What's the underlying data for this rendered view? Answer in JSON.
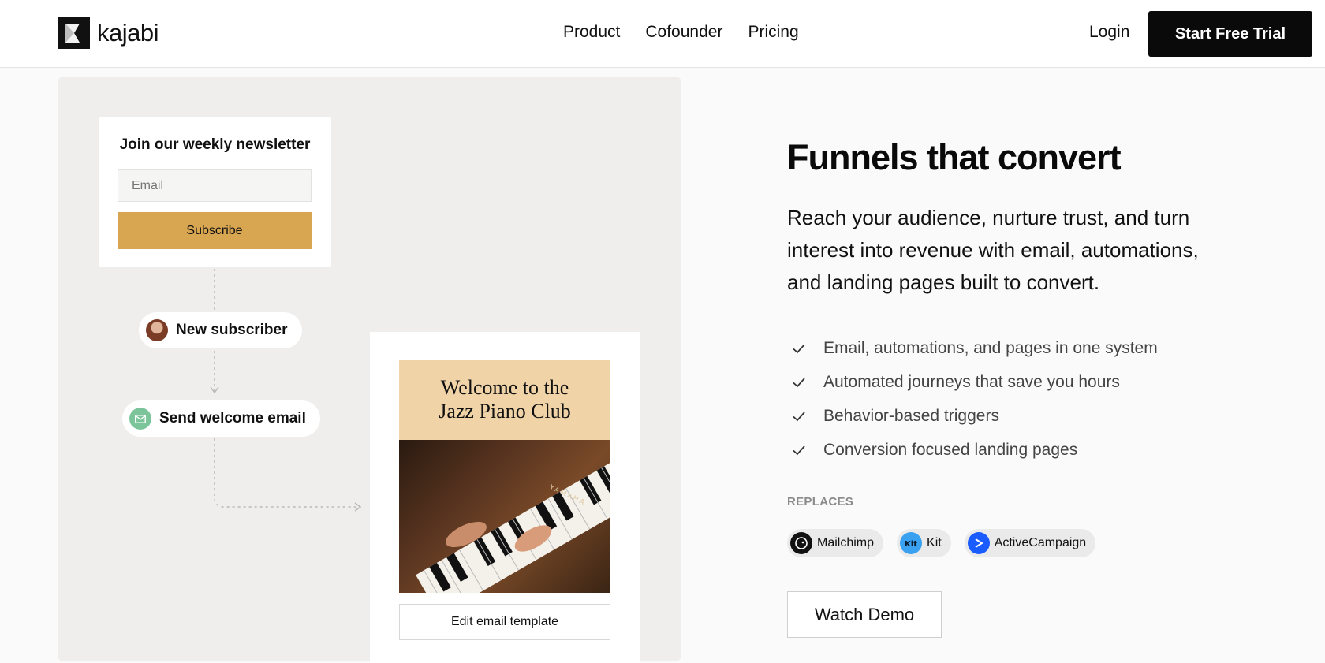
{
  "header": {
    "logo_text": "kajabi",
    "nav": [
      "Product",
      "Cofounder",
      "Pricing"
    ],
    "login_label": "Login",
    "cta_label": "Start Free Trial"
  },
  "illustration": {
    "newsletter": {
      "title": "Join our weekly newsletter",
      "email_placeholder": "Email",
      "subscribe_label": "Subscribe"
    },
    "steps": {
      "new_subscriber": "New subscriber",
      "send_welcome": "Send welcome email"
    },
    "email_preview": {
      "heading_line1": "Welcome to the",
      "heading_line2": "Jazz Piano Club",
      "brand_text": "YAMAHA",
      "edit_label": "Edit email template"
    }
  },
  "content": {
    "title": "Funnels that convert",
    "lede": "Reach your audience, nurture trust, and turn interest into revenue with email, automations, and landing pages built to convert.",
    "features": [
      "Email, automations, and pages in one system",
      "Automated journeys that save you hours",
      "Behavior-based triggers",
      "Conversion focused landing pages"
    ],
    "replaces_label": "REPLACES",
    "replaces": [
      {
        "name": "Mailchimp",
        "icon": "mailchimp-icon",
        "color": "#111111"
      },
      {
        "name": "Kit",
        "icon": "kit-icon",
        "color": "#3aa0f0"
      },
      {
        "name": "ActiveCampaign",
        "icon": "activecampaign-icon",
        "color": "#1a5cff"
      }
    ],
    "demo_label": "Watch Demo"
  },
  "colors": {
    "subscribe_button": "#d8a551",
    "email_hero_top": "#f0d4a8",
    "mail_icon_bg": "#7cc59b",
    "cta_bg": "#0a0a0a"
  }
}
